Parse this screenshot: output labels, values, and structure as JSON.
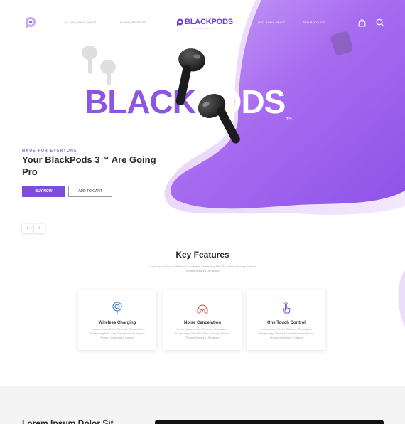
{
  "colors": {
    "accent": "#7c4ddb",
    "accent_light": "#b37af0",
    "heading": "#2a2a2a",
    "muted": "#a0a0a0"
  },
  "nav": {
    "links_left": [
      "BLACK PODS PRO™",
      "BLACK PODS 3™"
    ],
    "links_right": [
      "RED PODS PRO™",
      "RED PODS 3™"
    ],
    "logo_icon": "p-logo-icon",
    "brand_name": "BLACKPODS",
    "brand_sub": "ORIGINALS",
    "cart_icon": "shopping-bag-icon",
    "search_icon": "search-icon"
  },
  "hero": {
    "big_text_left": "BLACK",
    "big_text_right": "PODS",
    "superscript": "3™",
    "tagline": "MADE FOR EVERYONE",
    "title": "Your BlackPods 3™ Are Going Pro",
    "buy_label": "BUY NOW",
    "cart_label": "ADD TO CART",
    "prev_label": "‹",
    "next_label": "›"
  },
  "features": {
    "title": "Key Features",
    "subtitle": "Lorem Ipsum Dolor Sit Amet, Consetetur Sadipscing Elitr, Sed Diam Nonumy Eirmod Tempor Invidunt Ut Labore",
    "cards": [
      {
        "icon": "wireless-charging-icon",
        "title": "Wireless Charging",
        "desc": "Lorem Ipsum Dolor Sit Amet, Consetetur Sadipscing Elitr, Sed Diam Nonumy Eirmod Tempor Invidunt Ut Labore"
      },
      {
        "icon": "headphones-icon",
        "title": "Noise Cancelation",
        "desc": "Lorem Ipsum Dolor Sit Amet, Consetetur Sadipscing Elitr, Sed Diam Nonumy Eirmod Tempor Invidunt Ut Labore"
      },
      {
        "icon": "touch-hand-icon",
        "title": "One Touch Control",
        "desc": "Lorem Ipsum Dolor Sit Amet, Consetetur Sadipscing Elitr, Sed Diam Nonumy Eirmod Tempor Invidunt Ut Labore"
      }
    ]
  },
  "bottom": {
    "heading": "Lorem Ipsum Dolor Sit"
  }
}
